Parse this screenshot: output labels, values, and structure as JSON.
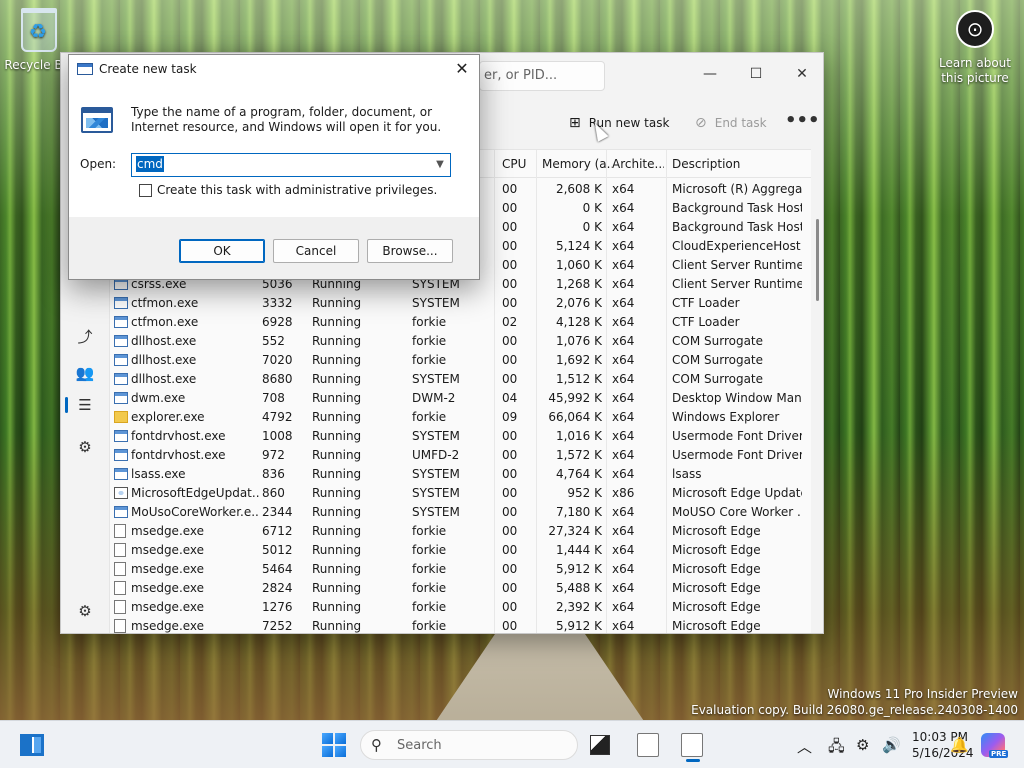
{
  "desktop": {
    "recycle_bin_label": "Recycle Bin",
    "learn_about_label": "Learn about this picture",
    "watermark_line1": "Windows 11 Pro Insider Preview",
    "watermark_line2": "Evaluation copy. Build 26080.ge_release.240308-1400"
  },
  "task_manager": {
    "search_placeholder": "er, or PID...",
    "run_new_task_label": "Run new task",
    "end_task_label": "End task",
    "more_label": "•••",
    "columns": {
      "cpu": "CPU",
      "memory": "Memory (a...",
      "arch": "Archite...",
      "description": "Description"
    },
    "rows": [
      {
        "name": "",
        "pid": "",
        "status": "",
        "user": "",
        "cpu": "00",
        "mem": "2,608 K",
        "arch": "x64",
        "desc": "Microsoft (R) Aggrega...",
        "icon": "window"
      },
      {
        "name": "",
        "pid": "",
        "status": "",
        "user": "",
        "cpu": "00",
        "mem": "0 K",
        "arch": "x64",
        "desc": "Background Task Host",
        "icon": "window"
      },
      {
        "name": "",
        "pid": "",
        "status": "",
        "user": "",
        "cpu": "00",
        "mem": "0 K",
        "arch": "x64",
        "desc": "Background Task Host",
        "icon": "window"
      },
      {
        "name": "",
        "pid": "",
        "status": "",
        "user": "",
        "cpu": "00",
        "mem": "5,124 K",
        "arch": "x64",
        "desc": "CloudExperienceHost ...",
        "icon": "window"
      },
      {
        "name": "",
        "pid": "",
        "status": "",
        "user": "",
        "cpu": "00",
        "mem": "1,060 K",
        "arch": "x64",
        "desc": "Client Server Runtime ...",
        "icon": "window"
      },
      {
        "name": "csrss.exe",
        "pid": "5036",
        "status": "Running",
        "user": "SYSTEM",
        "cpu": "00",
        "mem": "1,268 K",
        "arch": "x64",
        "desc": "Client Server Runtime ...",
        "icon": "window"
      },
      {
        "name": "ctfmon.exe",
        "pid": "3332",
        "status": "Running",
        "user": "SYSTEM",
        "cpu": "00",
        "mem": "2,076 K",
        "arch": "x64",
        "desc": "CTF Loader",
        "icon": "window"
      },
      {
        "name": "ctfmon.exe",
        "pid": "6928",
        "status": "Running",
        "user": "forkie",
        "cpu": "02",
        "mem": "4,128 K",
        "arch": "x64",
        "desc": "CTF Loader",
        "icon": "window"
      },
      {
        "name": "dllhost.exe",
        "pid": "552",
        "status": "Running",
        "user": "forkie",
        "cpu": "00",
        "mem": "1,076 K",
        "arch": "x64",
        "desc": "COM Surrogate",
        "icon": "window"
      },
      {
        "name": "dllhost.exe",
        "pid": "7020",
        "status": "Running",
        "user": "forkie",
        "cpu": "00",
        "mem": "1,692 K",
        "arch": "x64",
        "desc": "COM Surrogate",
        "icon": "window"
      },
      {
        "name": "dllhost.exe",
        "pid": "8680",
        "status": "Running",
        "user": "SYSTEM",
        "cpu": "00",
        "mem": "1,512 K",
        "arch": "x64",
        "desc": "COM Surrogate",
        "icon": "window"
      },
      {
        "name": "dwm.exe",
        "pid": "708",
        "status": "Running",
        "user": "DWM-2",
        "cpu": "04",
        "mem": "45,992 K",
        "arch": "x64",
        "desc": "Desktop Window Man...",
        "icon": "window"
      },
      {
        "name": "explorer.exe",
        "pid": "4792",
        "status": "Running",
        "user": "forkie",
        "cpu": "09",
        "mem": "66,064 K",
        "arch": "x64",
        "desc": "Windows Explorer",
        "icon": "folder"
      },
      {
        "name": "fontdrvhost.exe",
        "pid": "1008",
        "status": "Running",
        "user": "SYSTEM",
        "cpu": "00",
        "mem": "1,016 K",
        "arch": "x64",
        "desc": "Usermode Font Driver ...",
        "icon": "window"
      },
      {
        "name": "fontdrvhost.exe",
        "pid": "972",
        "status": "Running",
        "user": "UMFD-2",
        "cpu": "00",
        "mem": "1,572 K",
        "arch": "x64",
        "desc": "Usermode Font Driver ...",
        "icon": "window"
      },
      {
        "name": "lsass.exe",
        "pid": "836",
        "status": "Running",
        "user": "SYSTEM",
        "cpu": "00",
        "mem": "4,764 K",
        "arch": "x64",
        "desc": "lsass",
        "icon": "window"
      },
      {
        "name": "MicrosoftEdgeUpdat...",
        "pid": "860",
        "status": "Running",
        "user": "SYSTEM",
        "cpu": "00",
        "mem": "952 K",
        "arch": "x86",
        "desc": "Microsoft Edge Update",
        "icon": "update"
      },
      {
        "name": "MoUsoCoreWorker.e...",
        "pid": "2344",
        "status": "Running",
        "user": "SYSTEM",
        "cpu": "00",
        "mem": "7,180 K",
        "arch": "x64",
        "desc": "MoUSO Core Worker ...",
        "icon": "window"
      },
      {
        "name": "msedge.exe",
        "pid": "6712",
        "status": "Running",
        "user": "forkie",
        "cpu": "00",
        "mem": "27,324 K",
        "arch": "x64",
        "desc": "Microsoft Edge",
        "icon": "doc"
      },
      {
        "name": "msedge.exe",
        "pid": "5012",
        "status": "Running",
        "user": "forkie",
        "cpu": "00",
        "mem": "1,444 K",
        "arch": "x64",
        "desc": "Microsoft Edge",
        "icon": "doc"
      },
      {
        "name": "msedge.exe",
        "pid": "5464",
        "status": "Running",
        "user": "forkie",
        "cpu": "00",
        "mem": "5,912 K",
        "arch": "x64",
        "desc": "Microsoft Edge",
        "icon": "doc"
      },
      {
        "name": "msedge.exe",
        "pid": "2824",
        "status": "Running",
        "user": "forkie",
        "cpu": "00",
        "mem": "5,488 K",
        "arch": "x64",
        "desc": "Microsoft Edge",
        "icon": "doc"
      },
      {
        "name": "msedge.exe",
        "pid": "1276",
        "status": "Running",
        "user": "forkie",
        "cpu": "00",
        "mem": "2,392 K",
        "arch": "x64",
        "desc": "Microsoft Edge",
        "icon": "doc"
      },
      {
        "name": "msedge.exe",
        "pid": "7252",
        "status": "Running",
        "user": "forkie",
        "cpu": "00",
        "mem": "5,912 K",
        "arch": "x64",
        "desc": "Microsoft Edge",
        "icon": "doc"
      }
    ],
    "sidebar_icons": [
      "processes-icon",
      "users-icon",
      "details-icon",
      "services-icon",
      "settings-icon"
    ]
  },
  "run_dialog": {
    "title": "Create new task",
    "description": "Type the name of a program, folder, document, or Internet resource, and Windows will open it for you.",
    "open_label": "Open:",
    "input_value": "cmd",
    "admin_checkbox_label": "Create this task with administrative privileges.",
    "admin_checked": false,
    "ok_label": "OK",
    "cancel_label": "Cancel",
    "browse_label": "Browse..."
  },
  "taskbar": {
    "search_placeholder": "Search",
    "time": "10:03 PM",
    "date": "5/16/2024",
    "copilot_badge": "PRE",
    "accent_color": "#0067c0"
  }
}
